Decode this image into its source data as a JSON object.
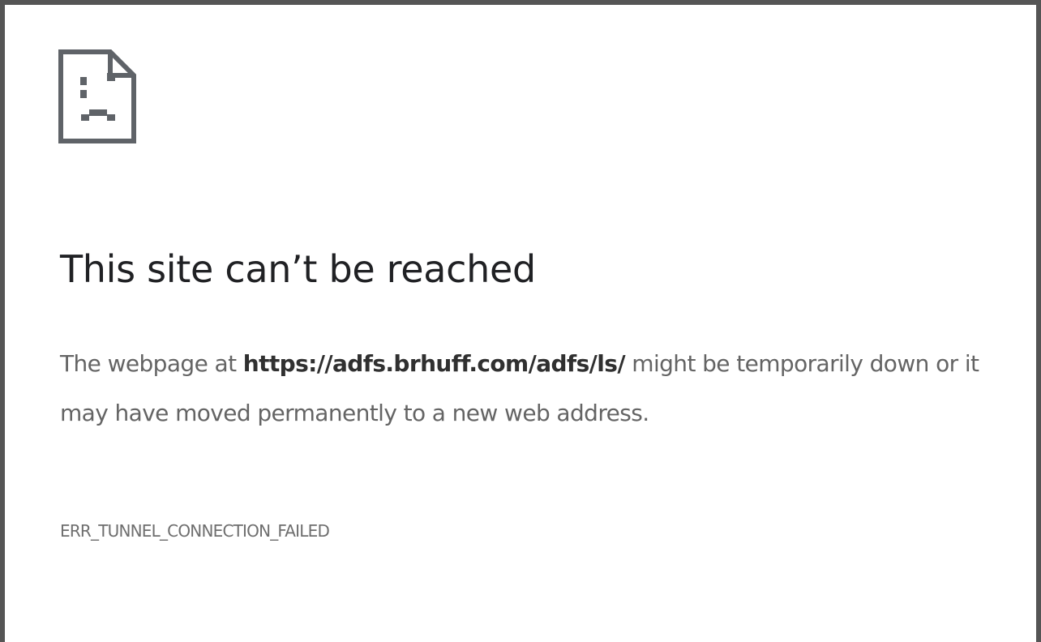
{
  "error_page": {
    "icon": "sad-document-icon",
    "headline": "This site can’t be reached",
    "message": {
      "prefix": "The webpage at ",
      "url": "https://adfs.brhuff.com/adfs/ls/",
      "suffix": " might be temporarily down or it may have moved permanently to a new web address."
    },
    "error_code": "ERR_TUNNEL_CONNECTION_FAILED"
  },
  "colors": {
    "border": "#555555",
    "background": "#ffffff",
    "headline": "#202124",
    "body_text": "#646464",
    "url_text": "#303030",
    "icon": "#5f6368"
  }
}
